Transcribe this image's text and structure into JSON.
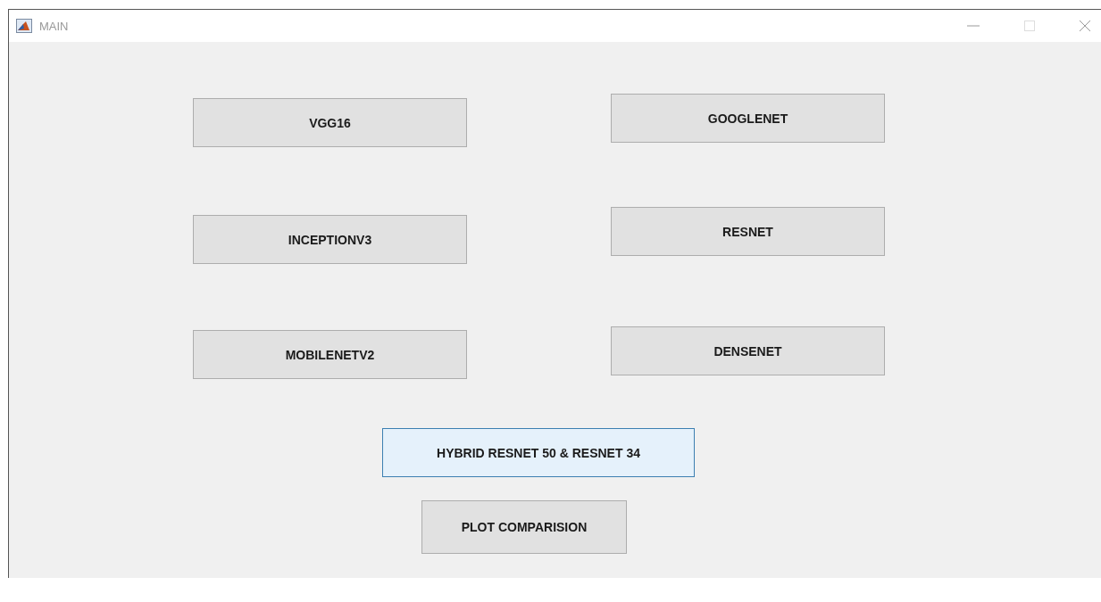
{
  "window": {
    "title": "MAIN"
  },
  "button_rows": [
    [
      {
        "label": "VGG16",
        "focused": false
      },
      {
        "label": "GOOGLENET",
        "focused": false
      }
    ],
    [
      {
        "label": "INCEPTIONV3",
        "focused": false
      },
      {
        "label": "RESNET",
        "focused": false
      }
    ],
    [
      {
        "label": "MOBILENETV2",
        "focused": false
      },
      {
        "label": "DENSENET",
        "focused": false
      }
    ]
  ],
  "bottom_buttons": [
    {
      "label": "HYBRID RESNET 50 & RESNET 34",
      "focused": true
    },
    {
      "label": "PLOT COMPARISION",
      "focused": false
    }
  ]
}
